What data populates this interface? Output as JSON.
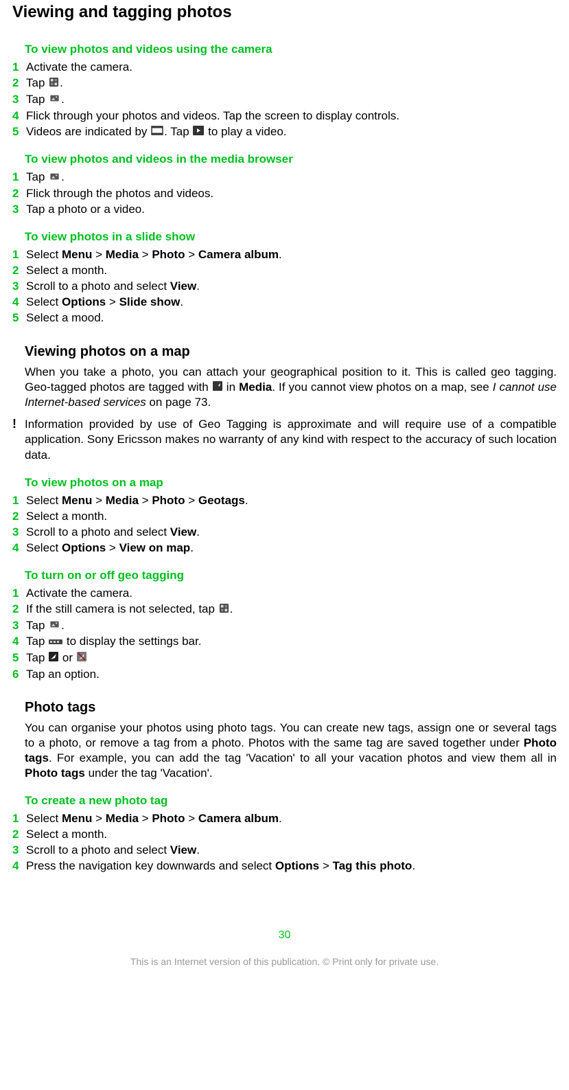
{
  "title": "Viewing and tagging photos",
  "sections": {
    "s1": {
      "heading": "To view photos and videos using the camera",
      "steps": [
        "Activate the camera.",
        "Tap {camera-mode-icon}.",
        "Tap {gallery-icon}.",
        "Flick through your photos and videos. Tap the screen to display controls.",
        "Videos are indicated by {video-frame-icon}. Tap {play-icon} to play a video."
      ]
    },
    "s2": {
      "heading": "To view photos and videos in the media browser",
      "steps": [
        "Tap {gallery-icon}.",
        "Flick through the photos and videos.",
        "Tap a photo or a video."
      ]
    },
    "s3": {
      "heading": "To view photos in a slide show",
      "steps": [
        "Select <b>Menu</b> > <b>Media</b> > <b>Photo</b> > <b>Camera album</b>.",
        "Select a month.",
        "Scroll to a photo and select <b>View</b>.",
        "Select <b>Options</b> > <b>Slide show</b>.",
        "Select a mood."
      ]
    },
    "map": {
      "h2": "Viewing photos on a map",
      "para_pre": "When you take a photo, you can attach your geographical position to it. This is called geo tagging. Geo-tagged photos are tagged with ",
      "para_mid": " in <b>Media</b>. If you cannot view photos on a map, see <i>I cannot use Internet-based services</i> on page 73.",
      "note": "Information provided by use of Geo Tagging is approximate and will require use of a compatible application. Sony Ericsson makes no warranty of any kind with respect to the accuracy of such location data."
    },
    "s4": {
      "heading": "To view photos on a map",
      "steps": [
        "Select <b>Menu</b> > <b>Media</b> > <b>Photo</b> > <b>Geotags</b>.",
        "Select a month.",
        "Scroll to a photo and select <b>View</b>.",
        "Select <b>Options</b> > <b>View on map</b>."
      ]
    },
    "s5": {
      "heading": "To turn on or off geo tagging",
      "steps": [
        "Activate the camera.",
        "If the still camera is not selected, tap {camera-mode-icon}.",
        "Tap {gallery-icon}.",
        "Tap {settings-bar-icon} to display the settings bar.",
        "Tap {geo-on-icon} or {geo-off-icon}",
        "Tap an option."
      ]
    },
    "tags": {
      "h2": "Photo tags",
      "para": "You can organise your photos using photo tags. You can create new tags, assign one or several tags to a photo, or remove a tag from a photo. Photos with the same tag are saved together under <b>Photo tags</b>. For example, you can add the tag 'Vacation' to all your vacation photos and view them all in <b>Photo tags</b> under the tag 'Vacation'."
    },
    "s6": {
      "heading": "To create a new photo tag",
      "steps": [
        "Select <b>Menu</b> > <b>Media</b> > <b>Photo</b> > <b>Camera album</b>.",
        "Select a month.",
        "Scroll to a photo and select <b>View</b>.",
        "Press the navigation key downwards and select <b>Options</b> > <b>Tag this photo</b>."
      ]
    }
  },
  "page_number": "30",
  "footer": "This is an Internet version of this publication. © Print only for private use."
}
